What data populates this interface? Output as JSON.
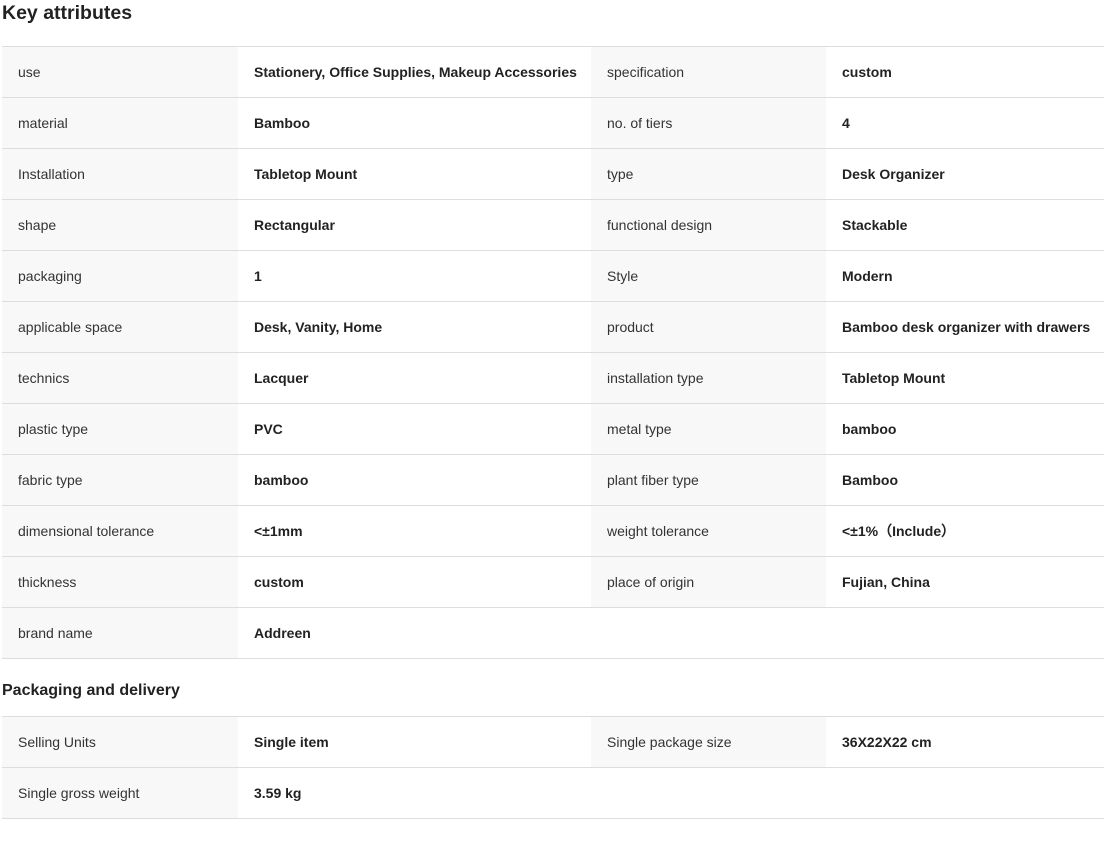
{
  "key_attributes": {
    "title": "Key attributes",
    "rows": [
      {
        "l1": "use",
        "v1": "Stationery, Office Supplies, Makeup Accessories",
        "l2": "specification",
        "v2": "custom"
      },
      {
        "l1": "material",
        "v1": "Bamboo",
        "l2": "no. of tiers",
        "v2": "4"
      },
      {
        "l1": "Installation",
        "v1": "Tabletop Mount",
        "l2": "type",
        "v2": "Desk Organizer"
      },
      {
        "l1": "shape",
        "v1": "Rectangular",
        "l2": "functional design",
        "v2": "Stackable"
      },
      {
        "l1": "packaging",
        "v1": "1",
        "l2": "Style",
        "v2": "Modern"
      },
      {
        "l1": "applicable space",
        "v1": "Desk, Vanity, Home",
        "l2": "product",
        "v2": "Bamboo desk organizer with drawers"
      },
      {
        "l1": "technics",
        "v1": "Lacquer",
        "l2": "installation type",
        "v2": "Tabletop Mount"
      },
      {
        "l1": "plastic type",
        "v1": "PVC",
        "l2": "metal type",
        "v2": "bamboo"
      },
      {
        "l1": "fabric type",
        "v1": "bamboo",
        "l2": "plant fiber type",
        "v2": "Bamboo"
      },
      {
        "l1": "dimensional tolerance",
        "v1": "<±1mm",
        "l2": "weight tolerance",
        "v2": "<±1%（Include）"
      },
      {
        "l1": "thickness",
        "v1": "custom",
        "l2": "place of origin",
        "v2": "Fujian, China"
      },
      {
        "l1": "brand name",
        "v1": "Addreen"
      }
    ]
  },
  "packaging_delivery": {
    "title": "Packaging and delivery",
    "rows": [
      {
        "l1": "Selling Units",
        "v1": "Single item",
        "l2": "Single package size",
        "v2": "36X22X22 cm"
      },
      {
        "l1": "Single gross weight",
        "v1": "3.59 kg"
      }
    ]
  }
}
